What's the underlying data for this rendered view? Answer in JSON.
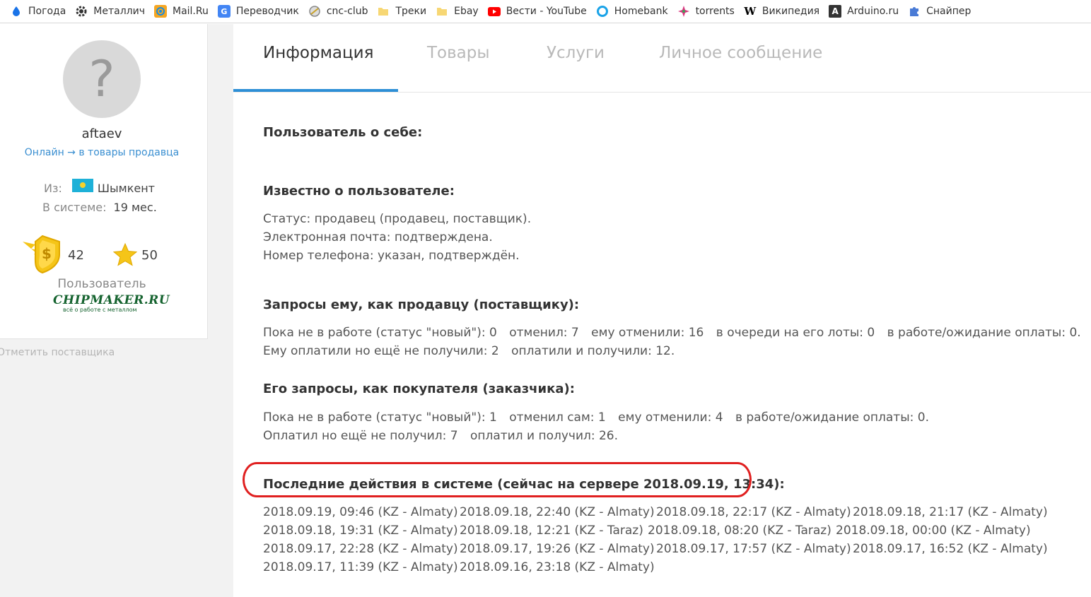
{
  "bookmarks": [
    {
      "label": "Погода",
      "icon": "droplet-icon",
      "color": "#1a73e8"
    },
    {
      "label": "Металлич",
      "icon": "gear-icon",
      "color": "#333333"
    },
    {
      "label": "Mail.Ru",
      "icon": "mailru-icon",
      "color": "#168de2"
    },
    {
      "label": "Переводчик",
      "icon": "translate-icon",
      "color": "#4285f4"
    },
    {
      "label": "cnc-club",
      "icon": "cnc-icon",
      "color": "#999999"
    },
    {
      "label": "Треки",
      "icon": "folder-icon",
      "color": "#f7d774"
    },
    {
      "label": "Ebay",
      "icon": "folder-icon",
      "color": "#f7d774"
    },
    {
      "label": "Вести - YouTube",
      "icon": "youtube-icon",
      "color": "#ff0000"
    },
    {
      "label": "Homebank",
      "icon": "homebank-icon",
      "color": "#1aa3e8"
    },
    {
      "label": "torrents",
      "icon": "torrents-icon",
      "color": "#d9347e"
    },
    {
      "label": "Википедия",
      "icon": "wikipedia-icon",
      "color": "#000000"
    },
    {
      "label": "Arduino.ru",
      "icon": "arduino-icon",
      "color": "#333333"
    },
    {
      "label": "Снайпер",
      "icon": "puzzle-icon",
      "color": "#4a7bd6"
    }
  ],
  "profile": {
    "avatar_glyph": "?",
    "username": "aftaev",
    "online_status": "Онлайн → в товары продавца",
    "from_label": "Из:",
    "city": "Шымкент",
    "since_label": "В системе:",
    "since_value": "19 мес.",
    "badge_money_count": "42",
    "badge_star_count": "50",
    "role": "Пользователь",
    "logo_text": "CHIPMAKER.RU",
    "logo_subtext": "всё о работе с металлом",
    "mark_supplier": "Отметить поставщика"
  },
  "tabs": [
    {
      "label": "Информация",
      "active": true
    },
    {
      "label": "Товары",
      "active": false
    },
    {
      "label": "Услуги",
      "active": false
    },
    {
      "label": "Личное сообщение",
      "active": false
    }
  ],
  "info": {
    "about_heading": "Пользователь о себе:",
    "known_heading": "Известно о пользователе:",
    "known_lines": [
      "Статус: продавец (продавец, поставщик).",
      "Электронная почта: подтверждена.",
      "Номер телефона: указан, подтверждён."
    ],
    "seller_heading": "Запросы ему, как продавцу (поставщику):",
    "seller_line1": [
      "Пока не в работе (статус \"новый\"): 0",
      "отменил: 7",
      "ему отменили: 16",
      "в очереди на его лоты: 0",
      "в работе/ожидание оплаты: 0."
    ],
    "seller_line2": [
      "Ему оплатили но ещё не получили: 2",
      "оплатили и получили: 12."
    ],
    "buyer_heading": "Его запросы, как покупателя (заказчика):",
    "buyer_line1": [
      "Пока не в работе (статус \"новый\"): 1",
      "отменил сам: 1",
      "ему отменили: 4",
      "в работе/ожидание оплаты: 0."
    ],
    "buyer_line2": [
      "Оплатил но ещё не получил: 7",
      "оплатил и получил: 26."
    ],
    "activity_heading": "Последние действия в системе (сейчас на сервере 2018.09.19, 13:34):",
    "activity": [
      "2018.09.19, 09:46 (KZ - Almaty)",
      "2018.09.18, 22:40 (KZ - Almaty)",
      "2018.09.18, 22:17 (KZ - Almaty)",
      "2018.09.18, 21:17 (KZ - Almaty)",
      "2018.09.18, 19:31 (KZ - Almaty)",
      "2018.09.18, 12:21 (KZ - Taraz)",
      "2018.09.18, 08:20 (KZ - Taraz)",
      "2018.09.18, 00:00 (KZ - Almaty)",
      "2018.09.17, 22:28 (KZ - Almaty)",
      "2018.09.17, 19:26 (KZ - Almaty)",
      "2018.09.17, 17:57 (KZ - Almaty)",
      "2018.09.17, 16:52 (KZ - Almaty)",
      "2018.09.17, 11:39 (KZ - Almaty)",
      "2018.09.16, 23:18 (KZ - Almaty)"
    ]
  },
  "colors": {
    "accent": "#2d8fd6",
    "highlight": "#e02020",
    "link": "#3a8fd1"
  }
}
